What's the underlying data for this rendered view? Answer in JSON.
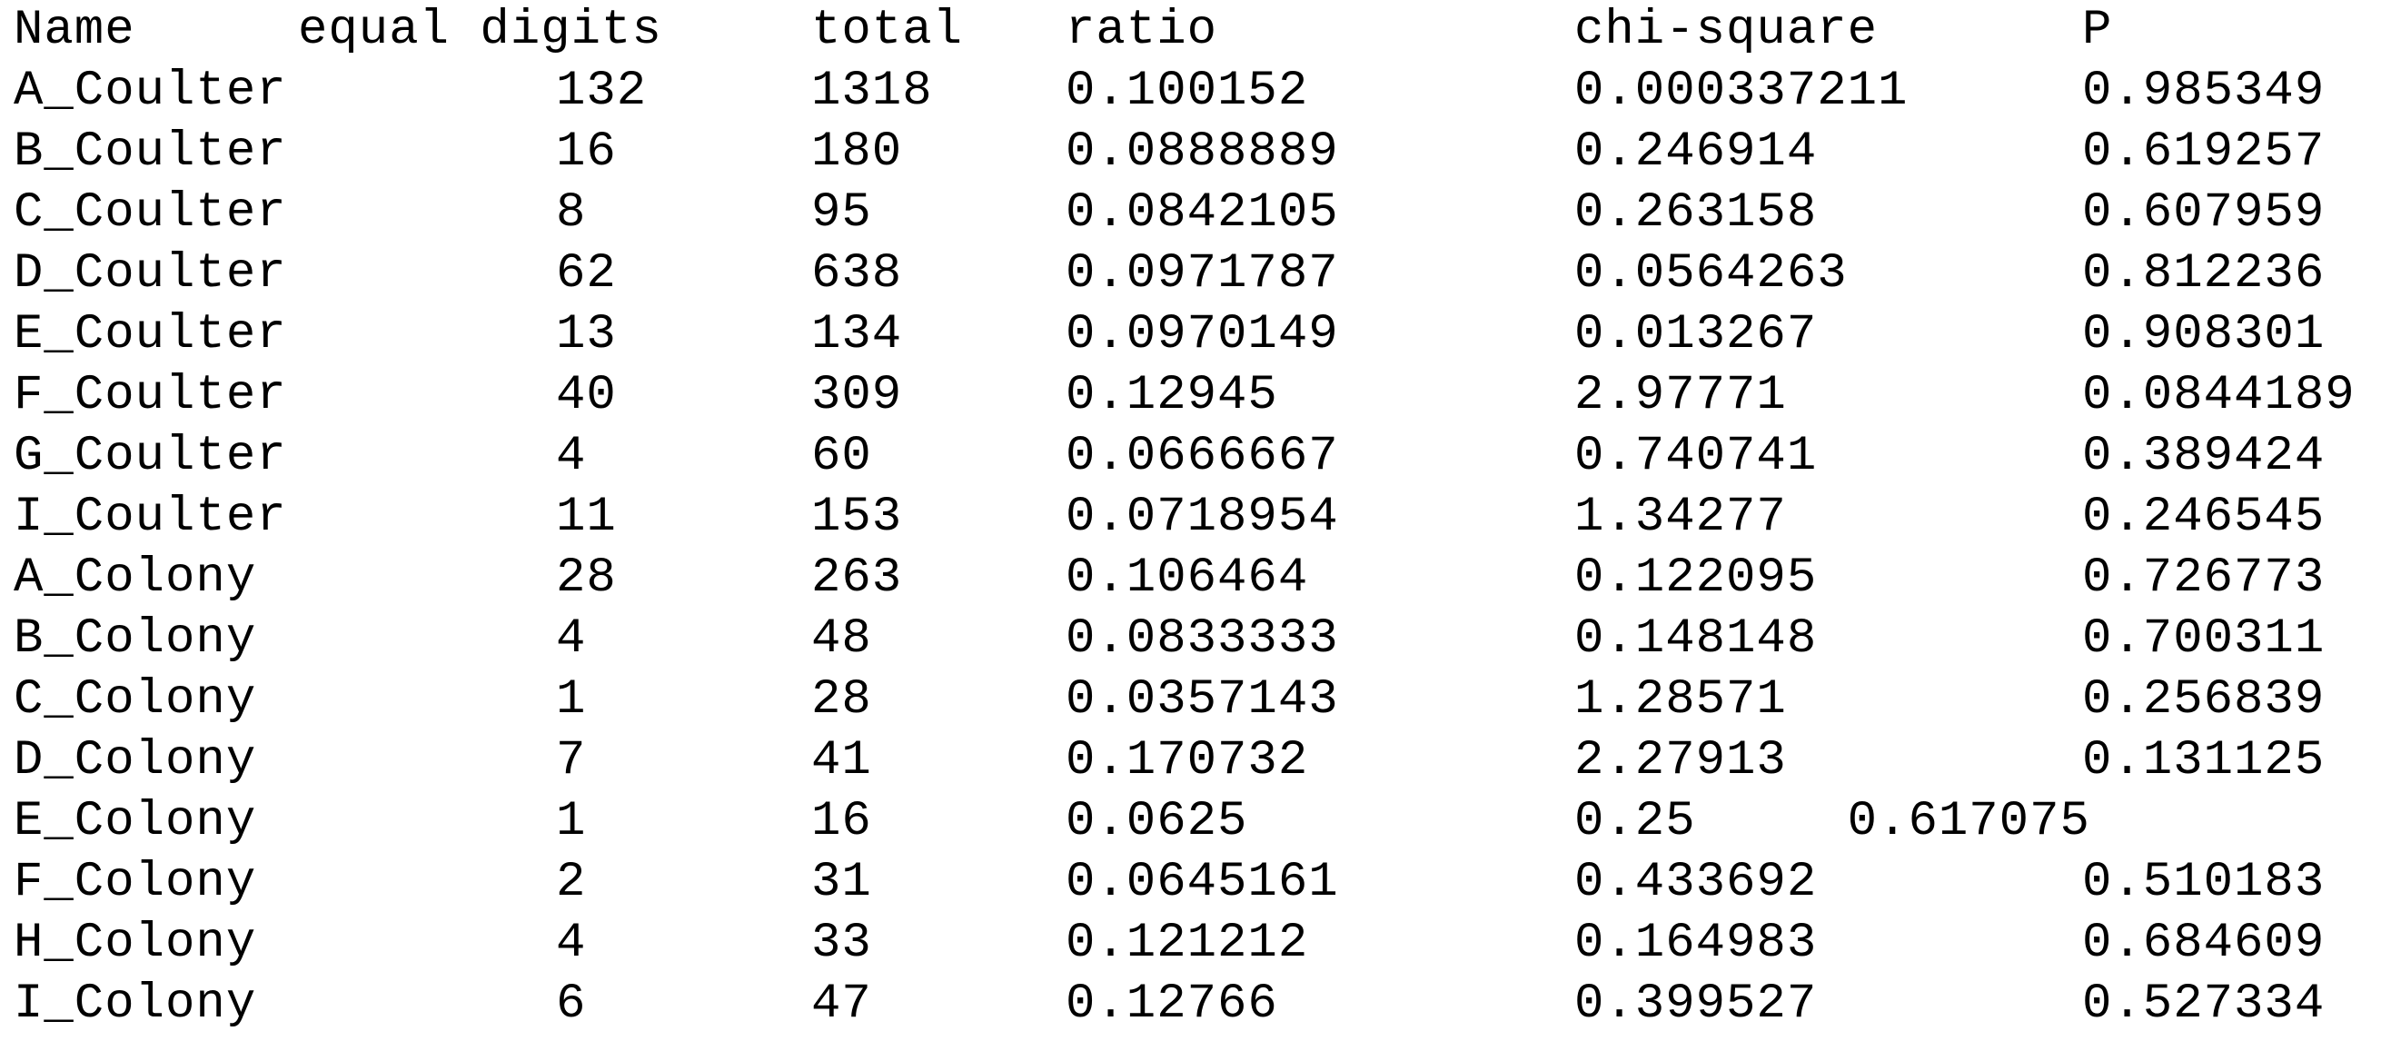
{
  "header": {
    "name": "Name",
    "equal_digits": "equal digits",
    "total": "total",
    "ratio": "ratio",
    "chi_square": "chi-square",
    "p": "P"
  },
  "rows": [
    {
      "name": "A_Coulter",
      "equal": "132",
      "total": "1318",
      "ratio": "0.100152",
      "chi": "0.000337211",
      "p": "0.985349"
    },
    {
      "name": "B_Coulter",
      "equal": "16",
      "total": "180",
      "ratio": "0.0888889",
      "chi": "0.246914",
      "p": "0.619257"
    },
    {
      "name": "C_Coulter",
      "equal": "8",
      "total": "95",
      "ratio": "0.0842105",
      "chi": "0.263158",
      "p": "0.607959"
    },
    {
      "name": "D_Coulter",
      "equal": "62",
      "total": "638",
      "ratio": "0.0971787",
      "chi": "0.0564263",
      "p": "0.812236"
    },
    {
      "name": "E_Coulter",
      "equal": "13",
      "total": "134",
      "ratio": "0.0970149",
      "chi": "0.013267",
      "p": "0.908301"
    },
    {
      "name": "F_Coulter",
      "equal": "40",
      "total": "309",
      "ratio": "0.12945",
      "chi": "2.97771",
      "p": "0.0844189"
    },
    {
      "name": "G_Coulter",
      "equal": "4",
      "total": "60",
      "ratio": "0.0666667",
      "chi": "0.740741",
      "p": "0.389424"
    },
    {
      "name": "I_Coulter",
      "equal": "11",
      "total": "153",
      "ratio": "0.0718954",
      "chi": "1.34277",
      "p": "0.246545"
    },
    {
      "name": "A_Colony",
      "equal": "28",
      "total": "263",
      "ratio": "0.106464",
      "chi": "0.122095",
      "p": "0.726773"
    },
    {
      "name": "B_Colony",
      "equal": "4",
      "total": "48",
      "ratio": "0.0833333",
      "chi": "0.148148",
      "p": "0.700311"
    },
    {
      "name": "C_Colony",
      "equal": "1",
      "total": "28",
      "ratio": "0.0357143",
      "chi": "1.28571",
      "p": "0.256839"
    },
    {
      "name": "D_Colony",
      "equal": "7",
      "total": "41",
      "ratio": "0.170732",
      "chi": "2.27913",
      "p": "0.131125"
    },
    {
      "name": "E_Colony",
      "equal": "1",
      "total": "16",
      "ratio": "0.0625",
      "chi_p_misaligned": "0.25     0.617075"
    },
    {
      "name": "F_Colony",
      "equal": "2",
      "total": "31",
      "ratio": "0.0645161",
      "chi": "0.433692",
      "p": "0.510183"
    },
    {
      "name": "H_Colony",
      "equal": "4",
      "total": "33",
      "ratio": "0.121212",
      "chi": "0.164983",
      "p": "0.684609"
    },
    {
      "name": "I_Colony",
      "equal": "6",
      "total": "47",
      "ratio": "0.12766",
      "chi": "0.399527",
      "p": "0.527334"
    }
  ]
}
